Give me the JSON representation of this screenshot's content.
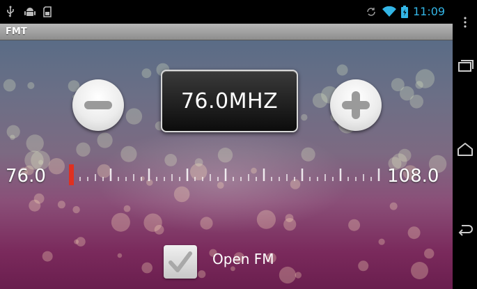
{
  "status_bar": {
    "time": "11:09",
    "icons": [
      "usb-icon",
      "android-debug-icon",
      "sd-card-icon",
      "sync-icon",
      "wifi-icon",
      "battery-icon"
    ]
  },
  "app": {
    "title": "FMT"
  },
  "radio": {
    "frequency": "76.0MHZ",
    "min_label": "76.0",
    "max_label": "108.0",
    "tuned_fraction": 0.0,
    "decrease_icon": "minus-icon",
    "increase_icon": "plus-icon"
  },
  "open_fm": {
    "label": "Open FM",
    "checked": true
  },
  "colors": {
    "accent": "#33b5e5",
    "tuner_marker": "#e03020"
  },
  "nav_bar": {
    "icons": [
      "overflow-menu-icon",
      "recents-icon",
      "home-icon",
      "back-icon"
    ]
  }
}
